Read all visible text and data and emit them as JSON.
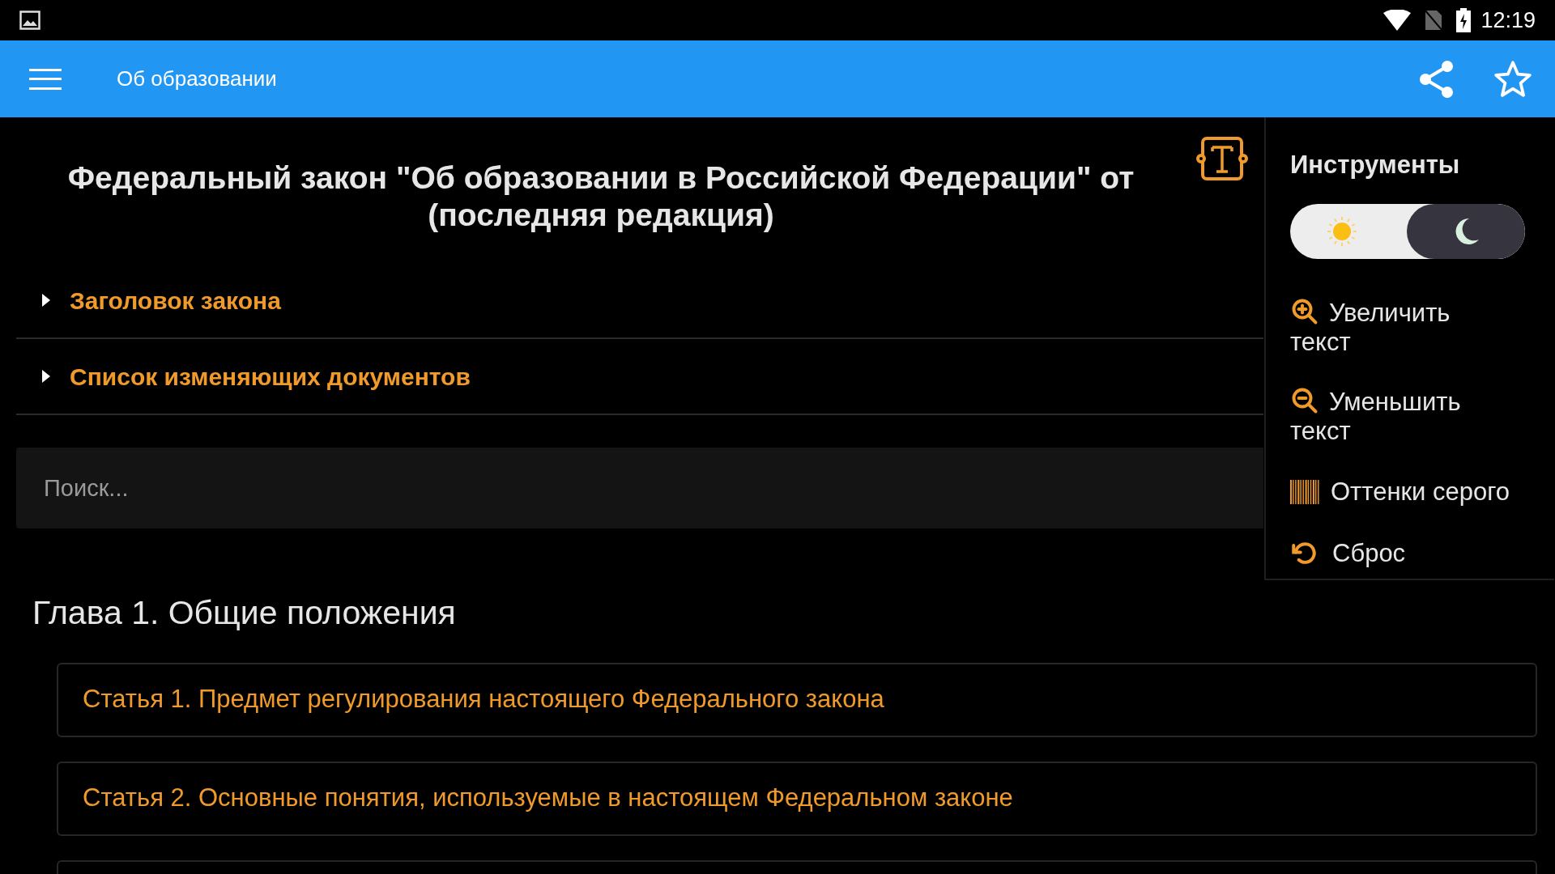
{
  "status_bar": {
    "time": "12:19"
  },
  "app_bar": {
    "title": "Об образовании"
  },
  "document": {
    "title": "Федеральный закон \"Об образовании в Российской Федерации\" от (последняя редакция)",
    "sections": [
      {
        "label": "Заголовок закона",
        "expanded": false
      },
      {
        "label": "Список изменяющих документов",
        "expanded": false
      }
    ],
    "search": {
      "placeholder": "Поиск..."
    },
    "chapter": "Глава 1. Общие положения",
    "articles": [
      {
        "label": "Статья 1. Предмет регулирования настоящего Федерального закона"
      },
      {
        "label": "Статья 2. Основные понятия, используемые в настоящем Федеральном законе"
      }
    ],
    "more_articles_below": true
  },
  "tools": {
    "title": "Инструменты",
    "dark_mode": true,
    "items": [
      {
        "kind": "zoom-in",
        "label": "Увеличить текст"
      },
      {
        "kind": "zoom-out",
        "label": "Уменьшить текст"
      },
      {
        "kind": "grayscale",
        "label": "Оттенки серого"
      },
      {
        "kind": "reset",
        "label": "Сброс"
      }
    ]
  }
}
